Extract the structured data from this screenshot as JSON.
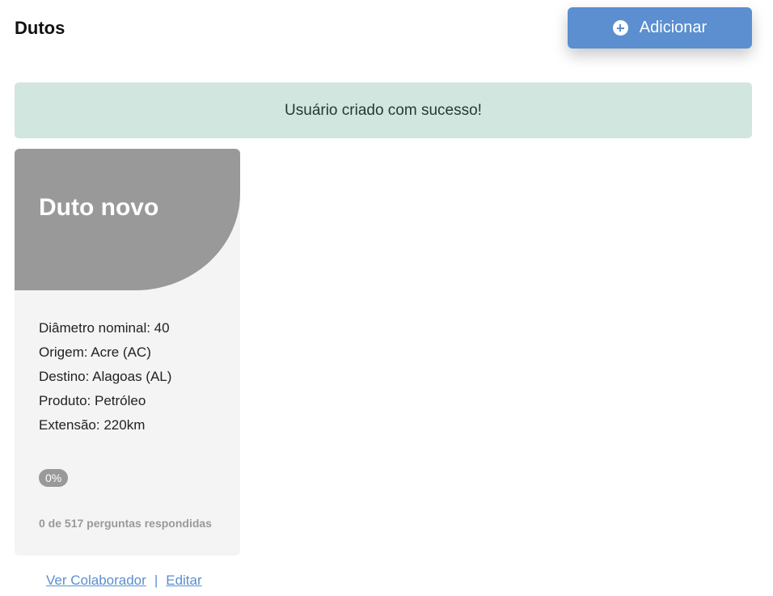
{
  "header": {
    "title": "Dutos",
    "add_button_label": "Adicionar",
    "add_icon": "plus-circle-icon"
  },
  "alert": {
    "message": "Usuário criado com sucesso!"
  },
  "card": {
    "title": "Duto novo",
    "details": [
      "Diâmetro nominal: 40",
      "Origem: Acre (AC)",
      "Destino: Alagoas (AL)",
      "Produto: Petróleo",
      "Extensão: 220km"
    ],
    "progress_label": "0%",
    "progress_fraction": 0,
    "answers_text": "0 de 517 perguntas respondidas",
    "links": {
      "view_label": "Ver Colaborador",
      "separator": "|",
      "edit_label": "Editar"
    }
  },
  "colors": {
    "accent": "#5b8fcf",
    "alert_bg": "#d1e6de",
    "card_header": "#999999",
    "card_bg": "#f4f4f4"
  }
}
